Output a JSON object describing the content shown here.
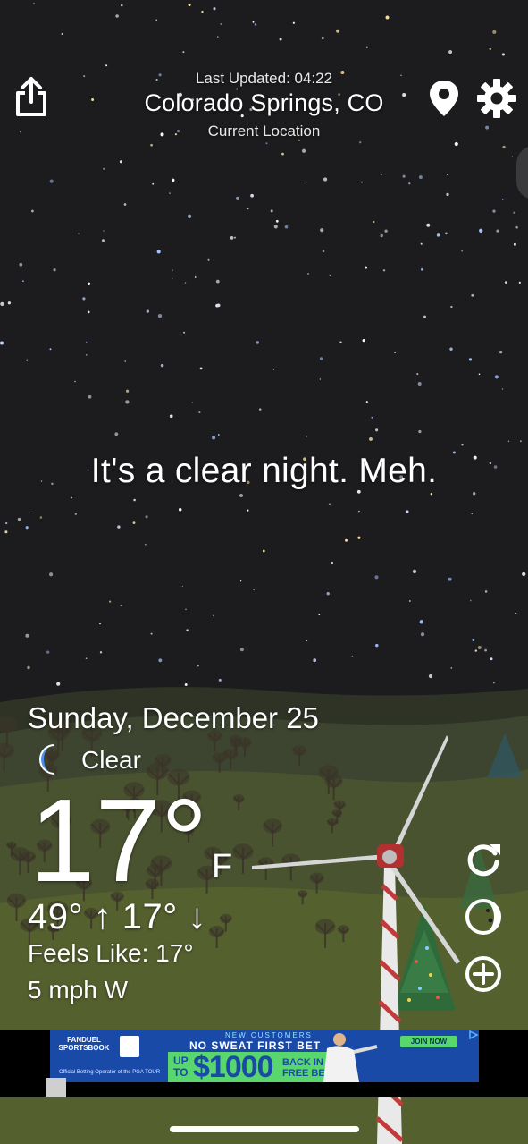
{
  "header": {
    "last_updated": "Last Updated: 04:22",
    "location": "Colorado Springs, CO",
    "location_sub": "Current Location"
  },
  "tagline": "It's a clear night. Meh.",
  "weather": {
    "date": "Sunday, December 25",
    "condition": "Clear",
    "condition_icon": "crescent-moon-icon",
    "temperature": "17°",
    "unit": "F",
    "hi_lo": "49° ↑  17° ↓",
    "feels_like": "Feels Like: 17°",
    "wind": "5 mph W"
  },
  "actions": {
    "share_icon": "share-icon",
    "location_icon": "location-pin-icon",
    "settings_icon": "gear-icon",
    "refresh_icon": "refresh-icon",
    "moon_phase_icon": "moon-phase-icon",
    "add_icon": "add-circle-icon"
  },
  "ad": {
    "brand": "FANDUEL SPORTSBOOK",
    "operator": "Official Betting Operator of the PGA TOUR",
    "new_customers": "NEW CUSTOMERS",
    "headline": "NO SWEAT FIRST BET",
    "up_to": "UP TO",
    "amount": "$1000",
    "back_in": "BACK IN FREE BETS",
    "cta": "JOIN NOW"
  },
  "colors": {
    "sky": "#1c1c1e",
    "hills_far": "#3f4630",
    "hills_near": "#4a5a2c",
    "ad_blue": "#1a4aa8",
    "ad_green": "#5ad66f"
  }
}
